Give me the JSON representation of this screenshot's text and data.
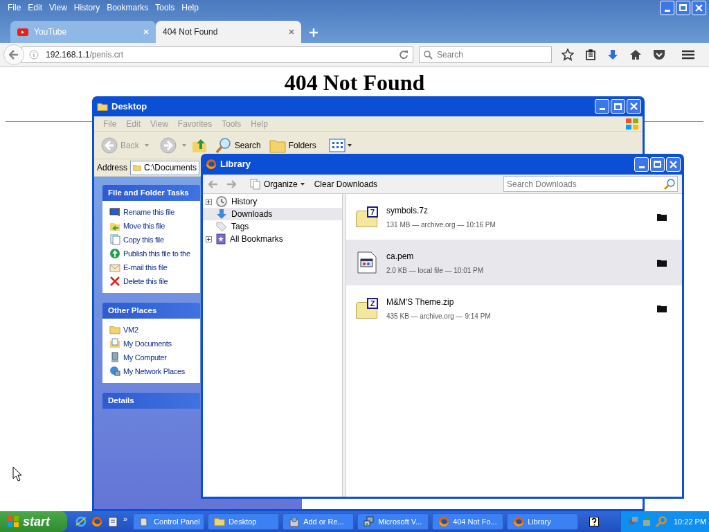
{
  "browser": {
    "menu": [
      "File",
      "Edit",
      "View",
      "History",
      "Bookmarks",
      "Tools",
      "Help"
    ],
    "tabs": [
      {
        "title": "YouTube",
        "kind": "youtube",
        "selected": false
      },
      {
        "title": "404 Not Found",
        "kind": "page",
        "selected": true
      }
    ],
    "url": {
      "host": "192.168.1.1",
      "path": "/penis.crt"
    },
    "search_placeholder": "Search",
    "page": {
      "heading": "404 Not Found"
    }
  },
  "explorer": {
    "title": "Desktop",
    "menu": [
      "File",
      "Edit",
      "View",
      "Favorites",
      "Tools",
      "Help"
    ],
    "toolbar": [
      {
        "label": "Back",
        "kind": "back",
        "disabled": true
      },
      {
        "label": "Search",
        "kind": "search",
        "disabled": false
      },
      {
        "label": "Folders",
        "kind": "folders",
        "disabled": false
      }
    ],
    "address": {
      "label": "Address",
      "value": "C:\\Documents"
    },
    "panels": [
      {
        "title": "File and Folder Tasks",
        "items": [
          {
            "label": "Rename this file",
            "kind": "rename"
          },
          {
            "label": "Move this file",
            "kind": "move"
          },
          {
            "label": "Copy this file",
            "kind": "copy"
          },
          {
            "label": "Publish this file to the",
            "kind": "publish"
          },
          {
            "label": "E-mail this file",
            "kind": "email"
          },
          {
            "label": "Delete this file",
            "kind": "delete"
          }
        ]
      },
      {
        "title": "Other Places",
        "items": [
          {
            "label": "VM2",
            "kind": "folder"
          },
          {
            "label": "My Documents",
            "kind": "documents"
          },
          {
            "label": "My Computer",
            "kind": "computer"
          },
          {
            "label": "My Network Places",
            "kind": "network"
          }
        ]
      },
      {
        "title": "Details"
      }
    ]
  },
  "library": {
    "title": "Library",
    "organize": "Organize",
    "clear": "Clear Downloads",
    "search_placeholder": "Search Downloads",
    "tree": [
      {
        "label": "History",
        "kind": "history",
        "expandable": true,
        "selected": false
      },
      {
        "label": "Downloads",
        "kind": "downloads",
        "expandable": false,
        "selected": true
      },
      {
        "label": "Tags",
        "kind": "tags",
        "expandable": false,
        "selected": false
      },
      {
        "label": "All Bookmarks",
        "kind": "bookmarks",
        "expandable": true,
        "selected": false
      }
    ],
    "downloads": [
      {
        "name": "symbols.7z",
        "details": "131 MB — archive.org — 10:16 PM",
        "kind": "archive",
        "badge": "7",
        "selected": false
      },
      {
        "name": "ca.pem",
        "details": "2.0 KB — local file — 10:01 PM",
        "kind": "certificate",
        "selected": true
      },
      {
        "name": "M&M'S Theme.zip",
        "details": "435 KB — archive.org — 9:14 PM",
        "kind": "archive",
        "badge": "Z",
        "selected": false
      }
    ]
  },
  "taskbar": {
    "start": "start",
    "more": "»",
    "tasks": [
      {
        "label": "Control Panel",
        "kind": "control"
      },
      {
        "label": "Desktop",
        "kind": "folder"
      },
      {
        "label": "Add or Re...",
        "kind": "install"
      },
      {
        "label": "Microsoft V...",
        "kind": "vm"
      },
      {
        "label": "404 Not Fo...",
        "kind": "firefox"
      },
      {
        "label": "Library",
        "kind": "firefox"
      }
    ],
    "clock": "10:22 PM"
  }
}
